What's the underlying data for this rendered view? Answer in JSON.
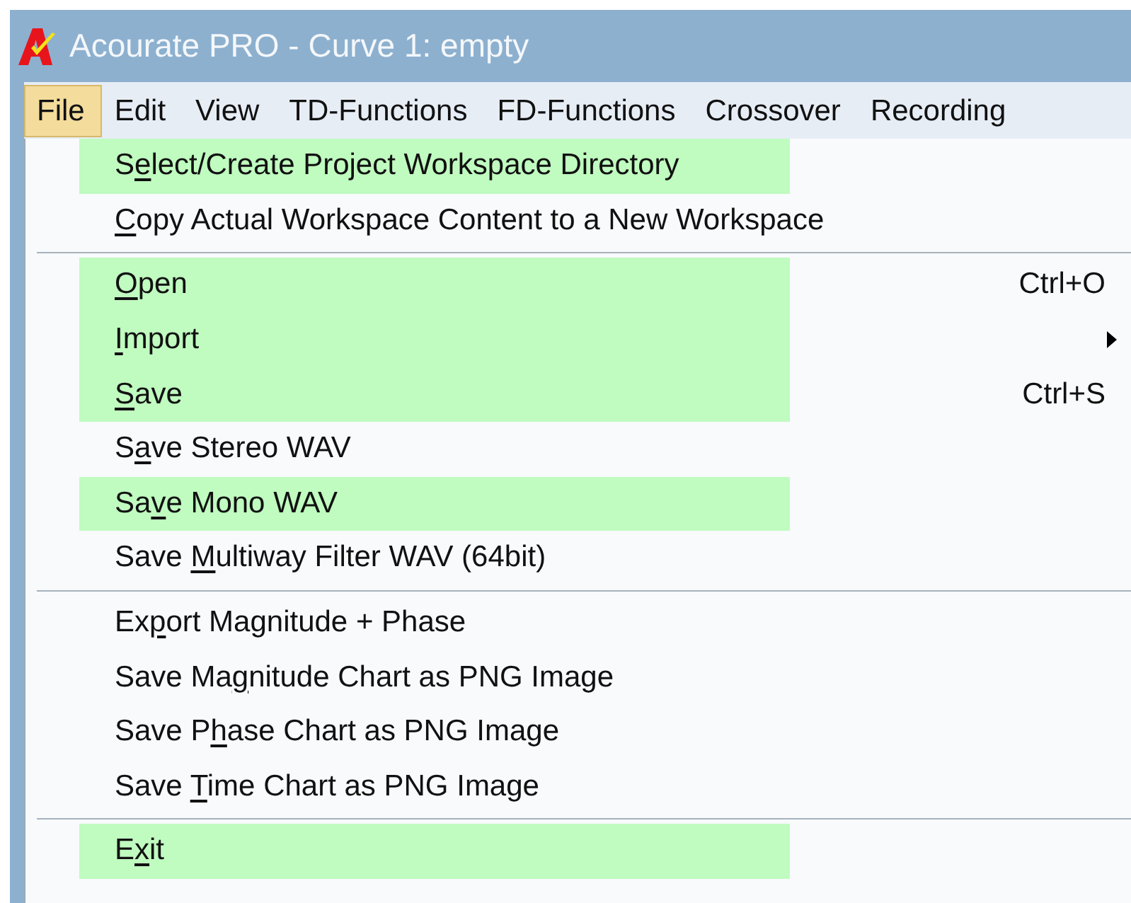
{
  "window": {
    "title": "Acourate PRO - Curve 1: empty"
  },
  "menu_bar": [
    {
      "label": "File",
      "selected": true
    },
    {
      "label": "Edit",
      "selected": false
    },
    {
      "label": "View",
      "selected": false
    },
    {
      "label": "TD-Functions",
      "selected": false
    },
    {
      "label": "FD-Functions",
      "selected": false
    },
    {
      "label": "Crossover",
      "selected": false
    },
    {
      "label": "Recording",
      "selected": false
    }
  ],
  "file_menu": [
    {
      "kind": "item",
      "before": "S",
      "key": "e",
      "after": "lect/Create Project Workspace Directory",
      "highlighted": true
    },
    {
      "kind": "item",
      "key": "C",
      "after": "opy Actual Workspace Content to a New Workspace",
      "highlighted": false
    },
    {
      "kind": "separator"
    },
    {
      "kind": "item",
      "key": "O",
      "after": "pen",
      "shortcut": "Ctrl+O",
      "highlighted": true
    },
    {
      "kind": "item",
      "key": "I",
      "after": "mport",
      "submenu": true,
      "highlighted": true
    },
    {
      "kind": "item",
      "key": "S",
      "after": "ave",
      "shortcut": "Ctrl+S",
      "highlighted": true
    },
    {
      "kind": "item",
      "before": "S",
      "key": "a",
      "after": "ve Stereo WAV",
      "highlighted": false
    },
    {
      "kind": "item",
      "before": "Sa",
      "key": "v",
      "after": "e Mono WAV",
      "highlighted": true
    },
    {
      "kind": "item",
      "before": "Save ",
      "key": "M",
      "after": "ultiway Filter WAV (64bit)",
      "highlighted": false
    },
    {
      "kind": "separator"
    },
    {
      "kind": "item",
      "before": "Ex",
      "key": "p",
      "after": "ort Magnitude + Phase",
      "highlighted": false
    },
    {
      "kind": "item",
      "before": "Save Ma",
      "key": "g",
      "after": "nitude Chart as PNG Image",
      "highlighted": false
    },
    {
      "kind": "item",
      "before": "Save P",
      "key": "h",
      "after": "ase Chart as PNG Image",
      "highlighted": false
    },
    {
      "kind": "item",
      "before": "Save ",
      "key": "T",
      "after": "ime Chart as PNG Image",
      "highlighted": false
    },
    {
      "kind": "separator"
    },
    {
      "kind": "item",
      "before": "E",
      "key": "x",
      "after": "it",
      "highlighted": true
    }
  ]
}
